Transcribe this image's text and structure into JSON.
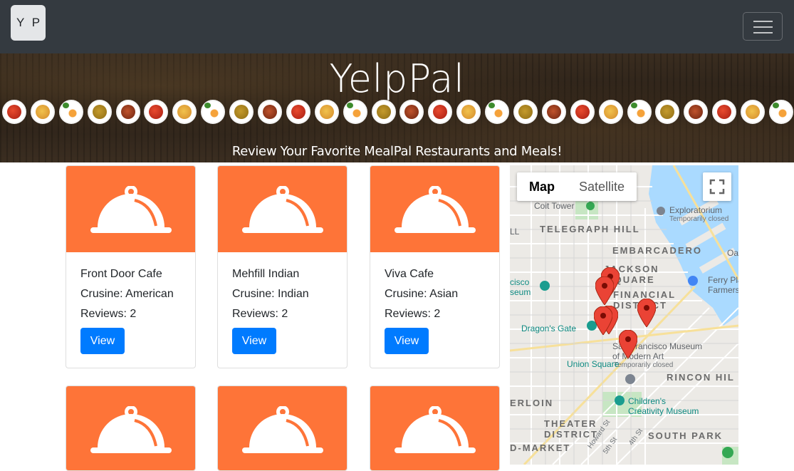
{
  "navbar": {
    "brand": "Y P",
    "menu_icon": "hamburger-icon"
  },
  "hero": {
    "title": "YelpPal",
    "subtitle": "Review Your Favorite MealPal Restaurants and Meals!"
  },
  "cards": [
    {
      "name": "Front Door Cafe",
      "cuisine": "Crusine: American",
      "reviews": "Reviews: 2",
      "button": "View"
    },
    {
      "name": "Mehfill Indian",
      "cuisine": "Crusine: Indian",
      "reviews": "Reviews: 2",
      "button": "View"
    },
    {
      "name": "Viva Cafe",
      "cuisine": "Crusine: Asian",
      "reviews": "Reviews: 2",
      "button": "View"
    },
    {
      "name": "",
      "cuisine": "",
      "reviews": "",
      "button": ""
    },
    {
      "name": "",
      "cuisine": "",
      "reviews": "",
      "button": ""
    },
    {
      "name": "",
      "cuisine": "",
      "reviews": "",
      "button": ""
    }
  ],
  "map": {
    "map_type_map": "Map",
    "map_type_satellite": "Satellite",
    "labels": {
      "coit_tower": "Coit Tower",
      "exploratorium": "Exploratorium",
      "exploratorium_status": "Temporarily closed",
      "telegraph_hill": "TELEGRAPH HILL",
      "embarcadero": "EMBARCADERO",
      "jackson_square_1": "JACKSON",
      "jackson_square_2": "SQUARE",
      "financial_1": "FINANCIAL",
      "financial_2": "DISTRICT",
      "museum_1": "cisco",
      "museum_2": "seum",
      "ferry_1": "Ferry Pla",
      "ferry_2": "Farmers",
      "dragons_gate": "Dragon's Gate",
      "sfmoma_1": "San Francisco Museum",
      "sfmoma_2": "of Modern Art",
      "sfmoma_status": "Temporarily closed",
      "union_square": "Union Square",
      "rincon_hill": "RINCON HIL",
      "childrens_1": "Children's",
      "childrens_2": "Creativity Museum",
      "tenderloin": "ERLOIN",
      "theater_1": "THEATER",
      "theater_2": "DISTRICT",
      "mid_market": "D-MARKET",
      "south_park": "SOUTH PARK",
      "oak": "Oa",
      "ll": "LL",
      "howard_st": "Howard St",
      "fifth_st": "5th St",
      "fourth_st": "4th St"
    },
    "accent_color": "#fe7438",
    "button_color": "#007bff",
    "pin_color": "#ea4335"
  }
}
